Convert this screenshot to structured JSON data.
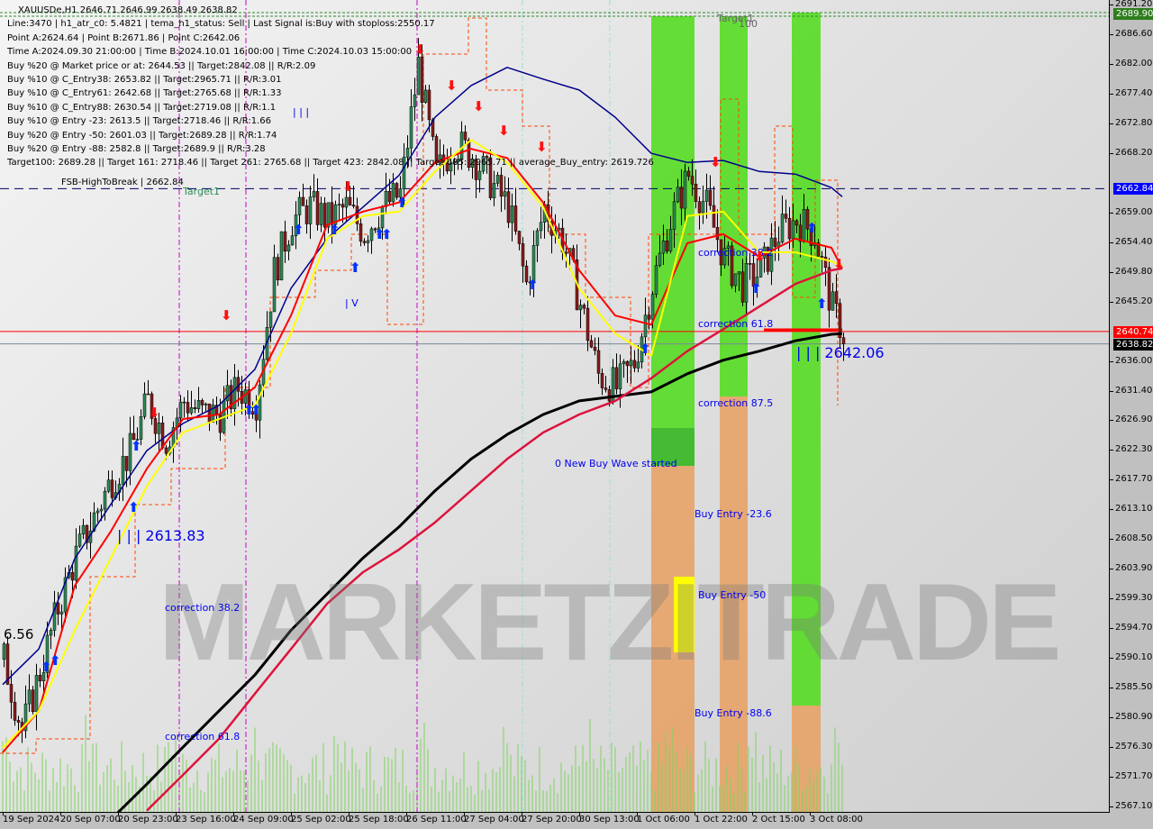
{
  "header": {
    "title": "XAUUSDe,H1  2646.71 2646.99 2638.49 2638.82",
    "lines": [
      "Line:3470 | h1_atr_c0: 5.4821 | tema_h1_status: Sell | Last Signal is:Buy with stoploss:2550.17",
      "Point A:2624.64 | Point B:2671.86 | Point C:2642.06",
      "Time A:2024.09.30 21:00:00 | Time B:2024.10.01 16:00:00 | Time C:2024.10.03 15:00:00",
      "Buy %20 @ Market price or at: 2644.53 || Target:2842.08 || R/R:2.09",
      "Buy %10 @ C_Entry38: 2653.82 || Target:2965.71 || R/R:3.01",
      "Buy %10 @ C_Entry61: 2642.68 || Target:2765.68 || R/R:1.33",
      "Buy %10 @ C_Entry88: 2630.54 || Target:2719.08 || R/R:1.1",
      "Buy %10 @ Entry -23: 2613.5 || Target:2718.46 || R/R:1.66",
      "Buy %20 @ Entry -50: 2601.03 || Target:2689.28 || R/R:1.74",
      "Buy %20 @ Entry -88: 2582.8 || Target:2689.9 || R/R:3.28",
      "Target100: 2689.28 || Target 161: 2718.46 || Target 261: 2765.68 || Target 423: 2842.08 || Target 685: 2965.71 || average_Buy_entry: 2619.726"
    ]
  },
  "annotations": {
    "fsb": "FSB-HighToBreak | 2662.84",
    "target1_left": "Target1",
    "target1_right": "Target1",
    "target100": "100",
    "corr382_left": "correction 38.2",
    "corr618_left": "correction 61.8",
    "point_2613": "| | | 2613.83",
    "val_656": "6.56",
    "new_wave": "0 New Buy Wave started",
    "buy_236": "Buy Entry -23.6",
    "buy_50": "Buy Entry -50",
    "buy_886": "Buy Entry -88.6",
    "corr382_right": "correction 38.2",
    "corr618_right": "correction 61.8",
    "corr875_right": "correction 87.5",
    "point_2642": "| | | 2642.06",
    "bars_top": "| | |",
    "bars_mid": "| V"
  },
  "watermark": "MARKETZITRADE",
  "colors": {
    "bull": "#2e8b57",
    "bear": "#8b1a1a",
    "ma_blue": "#00008b",
    "ma_black": "#000000",
    "ma_crimson": "#dc143c",
    "ma_red": "#ff0000",
    "ma_yellow": "#ffff00",
    "zone_green": "#55dd22",
    "zone_orange": "#e8a060"
  },
  "chart_data": {
    "type": "candlestick",
    "symbol": "XAUUSDe",
    "timeframe": "H1",
    "ylim": [
      2567.1,
      2691.2
    ],
    "y_ticks": [
      "2691.20",
      "2686.60",
      "2682.00",
      "2677.40",
      "2672.80",
      "2668.20",
      "2659.00",
      "2654.40",
      "2649.80",
      "2645.20",
      "2636.00",
      "2631.40",
      "2626.90",
      "2622.30",
      "2617.70",
      "2613.10",
      "2608.50",
      "2603.90",
      "2599.30",
      "2594.70",
      "2590.10",
      "2585.50",
      "2580.90",
      "2576.30",
      "2571.70",
      "2567.10"
    ],
    "x_ticks": [
      "19 Sep 2024",
      "20 Sep 07:00",
      "20 Sep 23:00",
      "23 Sep 16:00",
      "24 Sep 09:00",
      "25 Sep 02:00",
      "25 Sep 18:00",
      "26 Sep 11:00",
      "27 Sep 04:00",
      "27 Sep 20:00",
      "30 Sep 13:00",
      "1 Oct 06:00",
      "1 Oct 22:00",
      "2 Oct 15:00",
      "3 Oct 08:00"
    ],
    "price_labels": [
      {
        "value": "2689.90",
        "color": "#2e7d1e"
      },
      {
        "value": "2662.84",
        "color": "#0000ff"
      },
      {
        "value": "2640.74",
        "color": "#ff0000"
      },
      {
        "value": "2638.82",
        "color": "#000000"
      }
    ],
    "bar_index_step": 5,
    "closes": [
      2590,
      2579,
      2588,
      2598,
      2606,
      2612,
      2618,
      2622,
      2630,
      2624,
      2630,
      2628,
      2628,
      2632,
      2630,
      2650,
      2658,
      2660,
      2658,
      2660,
      2656,
      2660,
      2662,
      2682,
      2665,
      2670,
      2668,
      2664,
      2660,
      2648,
      2660,
      2655,
      2645,
      2634,
      2632,
      2636,
      2648,
      2658,
      2665,
      2660,
      2652,
      2648,
      2650,
      2656,
      2658,
      2656,
      2644,
      2638.82
    ],
    "ma_index_step": 10,
    "ma_blue": [
      2586.1,
      2591.6,
      2605.6,
      2614.0,
      2622.3,
      2626.5,
      2629.3,
      2634.9,
      2647.4,
      2655.1,
      2660.0,
      2664.9,
      2673.9,
      2678.8,
      2681.6,
      2679.8,
      2678.1,
      2673.9,
      2668.3,
      2666.9,
      2667.2,
      2665.5,
      2665.1,
      2663.0,
      2661.6
    ],
    "ma_red": [
      2575.6,
      2582.0,
      2601.4,
      2609.8,
      2619.5,
      2627.2,
      2627.9,
      2632.1,
      2643.2,
      2657.2,
      2659.3,
      2660.7,
      2666.9,
      2669.0,
      2667.6,
      2660.7,
      2650.2,
      2643.2,
      2641.8,
      2654.4,
      2655.8,
      2652.3,
      2655.1,
      2653.7,
      2650.5
    ],
    "ma_yellow": [
      2576.3,
      2582.0,
      2594.5,
      2605.7,
      2616.8,
      2625.1,
      2627.2,
      2629.3,
      2640.4,
      2655.1,
      2658.6,
      2659.3,
      2665.5,
      2670.4,
      2666.9,
      2660.0,
      2647.4,
      2640.4,
      2637.0,
      2658.6,
      2659.3,
      2653.0,
      2653.0,
      2651.6,
      2650.9
    ],
    "ma_black_start_index": 30,
    "ma_black": [
      2565.2,
      2570.7,
      2576.4,
      2582.0,
      2587.6,
      2594.5,
      2600.1,
      2605.7,
      2610.5,
      2616.1,
      2621.0,
      2624.8,
      2627.9,
      2630.0,
      2630.7,
      2631.4,
      2634.2,
      2636.3,
      2637.7,
      2639.3,
      2640.3,
      2640.4
    ],
    "ma_crimson_start_index": 40,
    "ma_crimson": [
      2566.6,
      2572.1,
      2577.7,
      2584.7,
      2591.6,
      2598.6,
      2603.5,
      2607.0,
      2611.2,
      2616.1,
      2621.0,
      2625.1,
      2627.9,
      2630.0,
      2633.5,
      2637.7,
      2641.1,
      2644.6,
      2648.1,
      2650.2,
      2650.5
    ]
  }
}
